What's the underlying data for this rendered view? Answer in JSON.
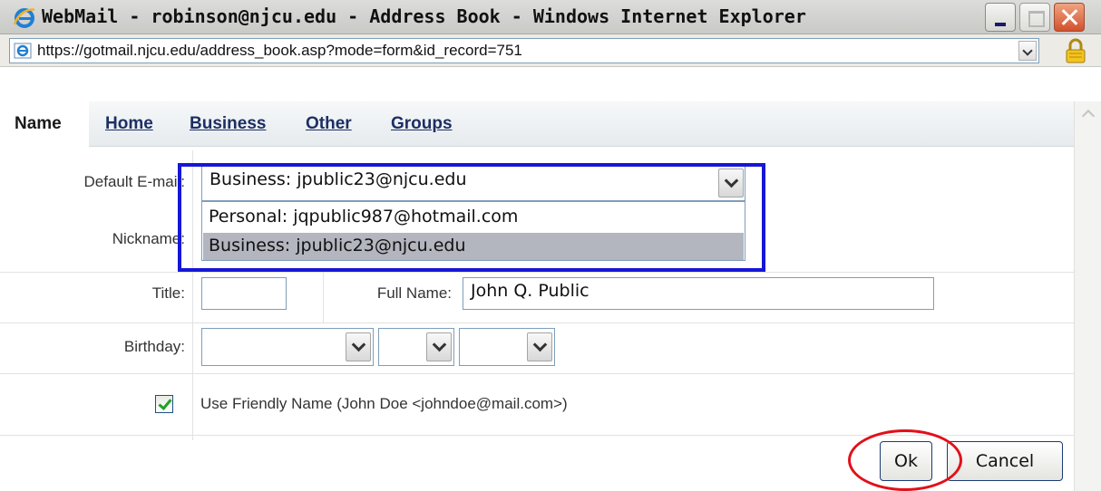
{
  "window": {
    "title": "WebMail - robinson@njcu.edu - Address Book - Windows Internet Explorer",
    "url": "https://gotmail.njcu.edu/address_book.asp?mode=form&id_record=751"
  },
  "tabs": {
    "name": "Name",
    "home": "Home",
    "business": "Business",
    "other": "Other",
    "groups": "Groups"
  },
  "form": {
    "default_email_label": "Default E-mail:",
    "default_email_value": "Business: jpublic23@njcu.edu",
    "email_options": [
      "Personal: jqpublic987@hotmail.com",
      "Business: jpublic23@njcu.edu"
    ],
    "nickname_label": "Nickname:",
    "title_label": "Title:",
    "title_value": "",
    "full_name_label": "Full Name:",
    "full_name_value": "John Q. Public",
    "birthday_label": "Birthday:",
    "friendly_name_label": "Use Friendly Name (John Doe <johndoe@mail.com>)",
    "friendly_name_checked": true
  },
  "buttons": {
    "ok": "Ok",
    "cancel": "Cancel"
  },
  "colors": {
    "highlight_box": "#1616d8",
    "ok_circle": "#e2101a",
    "tab_link": "#1d2f63"
  }
}
